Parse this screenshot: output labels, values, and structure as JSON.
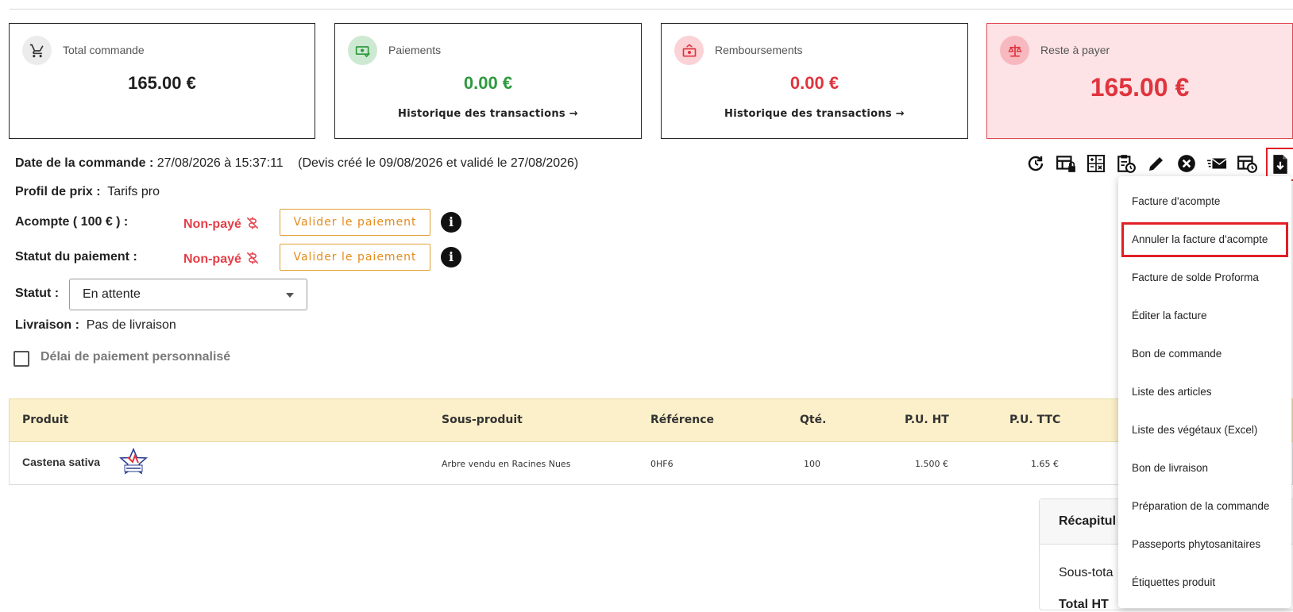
{
  "cards": {
    "total": {
      "title": "Total commande",
      "amount": "165.00 €",
      "amount_color": "#1f1f1f",
      "badge_bg": "#ececec"
    },
    "paiements": {
      "title": "Paiements",
      "amount": "0.00 €",
      "amount_color": "#2e9a3d",
      "badge_bg": "#cde9d2",
      "link": "Historique des transactions →"
    },
    "remboursements": {
      "title": "Remboursements",
      "amount": "0.00 €",
      "amount_color": "#e0343e",
      "badge_bg": "#fbd2d6",
      "link": "Historique des transactions →"
    },
    "reste": {
      "title": "Reste à payer",
      "amount": "165.00 €",
      "amount_color": "#e0343e",
      "badge_bg": "#f7b9bf"
    }
  },
  "order": {
    "date_label": "Date de la commande :",
    "date_value": " 27/08/2026 à 15:37:11",
    "devis_note": "(Devis créé le 09/08/2026 et validé le 27/08/2026)",
    "profil_label": "Profil de prix :",
    "profil_value": "Tarifs pro",
    "acompte_label": "Acompte ( 100 € ) :",
    "acompte_status": "Non-payé",
    "paiement_label": "Statut du paiement :",
    "paiement_status": "Non-payé",
    "validate_label": "Valider le paiement",
    "statut_label": "Statut :",
    "statut_value": "En attente",
    "livraison_label": "Livraison :",
    "livraison_value": "Pas de livraison",
    "delai_label": "Délai de paiement personnalisé"
  },
  "toolbar": {
    "icons": [
      "history-icon",
      "table-lock-icon",
      "calculator-icon",
      "clipboard-clock-icon",
      "pencil-icon",
      "close-circle-icon",
      "email-fast-icon",
      "table-clock-icon",
      "file-download-icon"
    ]
  },
  "table": {
    "headers": [
      "Produit",
      "Sous-produit",
      "Référence",
      "Qté.",
      "P.U. HT",
      "P.U. TTC"
    ],
    "rows": [
      [
        "Castena sativa",
        "Arbre vendu en Racines Nues",
        "0HF6",
        "100",
        "1.500 €",
        "1.65 €"
      ]
    ]
  },
  "recap": {
    "title": "Récapitul",
    "sous_total": "Sous-tota",
    "total_ht": "Total HT"
  },
  "menu": {
    "items": [
      "Facture d'acompte",
      "Annuler la facture d'acompte",
      "Facture de solde Proforma",
      "Éditer la facture",
      "Bon de commande",
      "Liste des articles",
      "Liste des végétaux (Excel)",
      "Bon de livraison",
      "Préparation de la commande",
      "Passeports phytosanitaires",
      "Étiquettes produit"
    ],
    "active_index": 1
  },
  "colors": {
    "accent_red": "#e01f26",
    "orange": "#e38b1a",
    "header_bg": "#fbf0c9"
  }
}
